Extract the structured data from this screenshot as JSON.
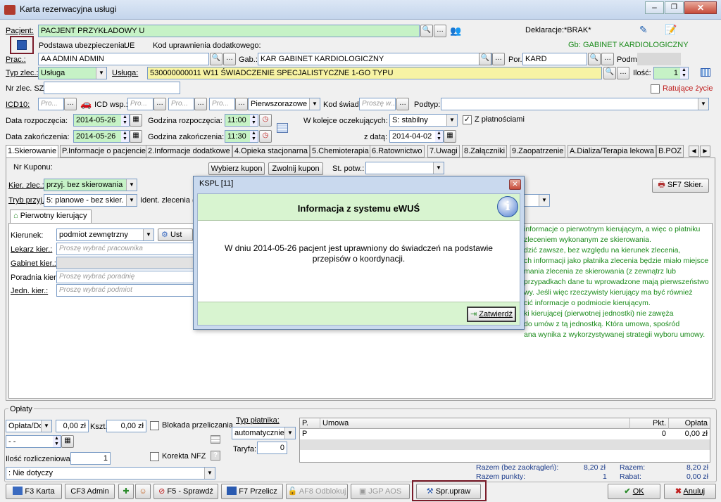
{
  "window": {
    "title": "Karta rezerwacyjna usługi"
  },
  "patient": {
    "label": "Pacjent:",
    "value": "PACJENT PRZYKŁADOWY U",
    "declaration_label": "Deklaracje:",
    "declaration_value": "*BRAK*",
    "insurance_label": "Podstawa ubezpieczenia:",
    "insurance_value": "UE",
    "extra_label": "Kod uprawnienia dodatkowego:",
    "gb_label": "Gb:",
    "gb_value": "GABINET KARDIOLOGICZNY"
  },
  "staff": {
    "prac_label": "Prac.:",
    "prac_value": "AA ADMIN ADMIN",
    "gab_label": "Gab.:",
    "gab_value": "KAR GABINET KARDIOLOGICZNY",
    "por_label": "Por.",
    "por_value": "KARD",
    "podm_label": "Podm"
  },
  "order": {
    "type_label": "Typ zlec.:",
    "type_value": "Usługa",
    "service_label": "Usługa:",
    "service_value": "530000000011 W11 ŚWIADCZENIE SPECJALISTYCZNE 1-GO TYPU",
    "qty_label": "Ilość:",
    "qty_value": "1",
    "nr_label": "Nr zlec. SZ:",
    "rescue_label": "Ratujące życie"
  },
  "icd": {
    "icd10_label": "ICD10:",
    "icd_wsp_label": "ICD wsp.:",
    "placeholder": "Pro...",
    "order_value": "Pierwszorazowe",
    "kod_label": "Kod świad.",
    "kod_placeholder": "Proszę w...",
    "podtyp_label": "Podtyp:"
  },
  "dates": {
    "start_label": "Data rozpoczęcia:",
    "start_value": "2014-05-26",
    "start_time_label": "Godzina rozpoczęcia:",
    "start_time_value": "11:00",
    "end_label": "Data zakończenia:",
    "end_value": "2014-05-26",
    "end_time_label": "Godzina zakończenia:",
    "end_time_value": "11:30",
    "queue_label": "W kolejce oczekujących:",
    "queue_value": "S: stabilny",
    "paid_label": "Z płatnościami",
    "from_date_label": "z datą:",
    "from_date_value": "2014-04-02"
  },
  "tabs": [
    "1.Skierowanie",
    "P.Informacje o pacjencie",
    "2.Informacje dodatkowe",
    "4.Opieka stacjonarna",
    "5.Chemioterapia",
    "6.Ratownictwo",
    "7.Uwagi",
    "8.Załączniki",
    "9.Zaopatrzenie",
    "A.Dializa/Terapia lekowa",
    "B.POZ"
  ],
  "referral": {
    "coupon_label": "Nr Kuponu:",
    "choose_coupon": "Wybierz kupon",
    "release_coupon": "Zwolnij kupon",
    "st_label": "St. potw.:",
    "kier_label": "Kier. zlec.:",
    "kier_value": "przyj. bez skierowania",
    "tryb_label": "Tryb przyj.:",
    "tryb_value": "5: planowe - bez skier.",
    "ident_label": "Ident. zlecenia (K",
    "sf7_label": "SF7 Skier.",
    "subtab": "Pierwotny kierujący",
    "kierunek_label": "Kierunek:",
    "kierunek_value": "podmiot zewnętrzny",
    "ust_label": "Ust",
    "lekarz_label": "Lekarz kier.:",
    "lekarz_placeholder": "Proszę wybrać pracownika",
    "gabinet_label": "Gabinet kier.:",
    "poradnia_label": "Poradnia kier.:",
    "poradnia_placeholder": "Proszę wybrać poradnię",
    "jedn_label": "Jedn. kier.:",
    "jedn_placeholder": "Proszę wybrać podmiot",
    "info_lines": [
      "informacje o pierwotnym kierującym, a więc o płatniku",
      "zleceniem wykonanym ze skierowania.",
      "dzić zawsze, bez względu na kierunek zlecenia,",
      "ch informacji jako płatnika zlecenia będzie miało miejsce",
      "mania zlecenia ze skierowania (z zewnątrz lub",
      "przypadkach dane tu wprowadzone mają pierwszeństwo",
      "wy. Jeśli więc rzeczywisty kierujący ma być również",
      "cić informacje o podmiocie kierującym.",
      "ki kierującej (pierwotnej jednostki) nie zawęża",
      "do umów z tą jednostką. Która umowa, spośród",
      "ana wynika z wykorzystywanej strategii wyboru umowy."
    ]
  },
  "dialog": {
    "title": "KSPL [11]",
    "heading": "Informacja z systemu eWUŚ",
    "message": "W dniu 2014-05-26 pacjent jest uprawniony do świadczeń na podstawie przepisów o koordynacji.",
    "confirm": "Zatwierdź"
  },
  "payments": {
    "group_label": "Opłaty",
    "opl_value": "Opłata/Do",
    "amount1": "0,00 zł",
    "ksz_label": "Kszt.:",
    "amount2": "0,00 zł",
    "blokada_label": "Blokada przeliczania",
    "date_value": "  -  -",
    "korekta_label": "Korekta NFZ",
    "ilosc_label": "Ilość rozliczeniowa:",
    "ilosc_value": "1",
    "nie_dotyczy": ": Nie dotyczy",
    "typ_label": "Typ płatnika:",
    "typ_value": "automatycznie",
    "taryfa_label": "Taryfa:",
    "taryfa_value": "0",
    "table_headers": [
      "P.",
      "Umowa",
      "Pkt.",
      "Opłata"
    ],
    "table_rows": [
      [
        "P",
        "",
        "0",
        "0,00 zł"
      ]
    ],
    "razem_bez_label": "Razem (bez zaokrągleń):",
    "razem_bez_value": "8,20 zł",
    "razem_pkt_label": "Razem punkty:",
    "razem_pkt_value": "1",
    "razem_label": "Razem:",
    "razem_value": "8,20 zł",
    "rabat_label": "Rabat:",
    "rabat_value": "0,00 zł"
  },
  "footer": {
    "f3": "F3 Karta",
    "cf3": "CF3 Admin",
    "f5": "F5 - Sprawdź",
    "f7": "F7 Przelicz",
    "af8": "AF8 Odblokuj",
    "jgp": "JGP AOS",
    "spr": "Spr.upraw",
    "ok": "OK",
    "cancel": "Anuluj"
  }
}
